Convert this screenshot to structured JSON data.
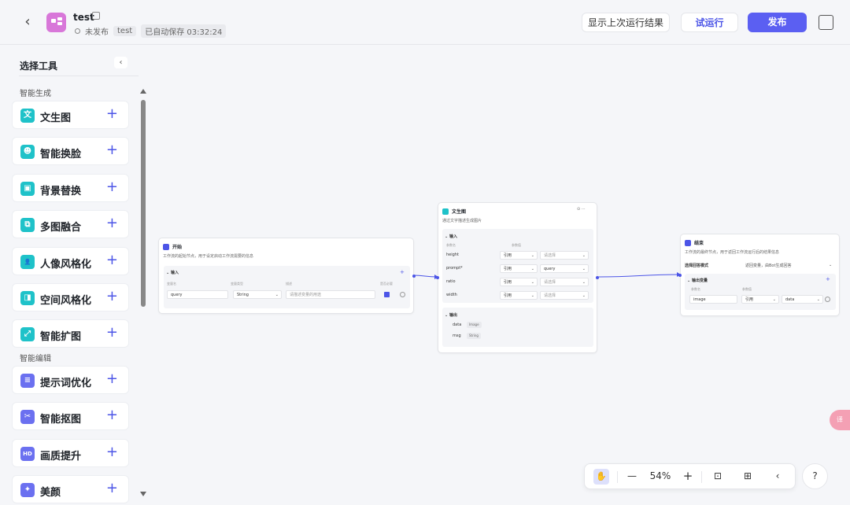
{
  "header": {
    "title": "test",
    "status": "未发布",
    "tag": "test",
    "autosave": "已自动保存 03:32:24",
    "buttons": {
      "last_result": "显示上次运行结果",
      "try_run": "试运行",
      "publish": "发布"
    }
  },
  "sidebar": {
    "title": "选择工具",
    "sections": [
      {
        "label": "智能生成",
        "items": [
          {
            "label": "文生图",
            "icon": "text-to-image-icon",
            "color": "#1fc2c9",
            "glyph": "文"
          },
          {
            "label": "智能换脸",
            "icon": "face-swap-icon",
            "color": "#1fc2c9",
            "glyph": "☻"
          },
          {
            "label": "背景替换",
            "icon": "background-replace-icon",
            "color": "#1fc2c9",
            "glyph": "▣"
          },
          {
            "label": "多图融合",
            "icon": "multi-image-fusion-icon",
            "color": "#1fc2c9",
            "glyph": "⧉"
          },
          {
            "label": "人像风格化",
            "icon": "portrait-stylize-icon",
            "color": "#1fc2c9",
            "glyph": "👤"
          },
          {
            "label": "空间风格化",
            "icon": "space-stylize-icon",
            "color": "#1fc2c9",
            "glyph": "◨"
          },
          {
            "label": "智能扩图",
            "icon": "image-expand-icon",
            "color": "#1fc2c9",
            "glyph": "⤢"
          }
        ]
      },
      {
        "label": "智能编辑",
        "items": [
          {
            "label": "提示词优化",
            "icon": "prompt-optimize-icon",
            "color": "#6b70f0",
            "glyph": "≡"
          },
          {
            "label": "智能抠图",
            "icon": "smart-cutout-icon",
            "color": "#6b70f0",
            "glyph": "✂"
          },
          {
            "label": "画质提升",
            "icon": "quality-enhance-icon",
            "color": "#6b70f0",
            "glyph": "HD"
          },
          {
            "label": "美颜",
            "icon": "beauty-icon",
            "color": "#6b70f0",
            "glyph": "✦"
          }
        ]
      }
    ]
  },
  "nodes": {
    "start": {
      "title": "开始",
      "desc": "工作流的起始节点，用于设定启动工作流需要的信息",
      "input_label": "输入",
      "cols": [
        "变量名",
        "变量类型",
        "描述",
        "是否必要"
      ],
      "row": {
        "name": "query",
        "type": "String",
        "desc_placeholder": "请描述变量的用途"
      }
    },
    "t2i": {
      "title": "文生图",
      "desc": "通过文字描述生成图片",
      "input_label": "输入",
      "cols": [
        "参数名",
        "参数值"
      ],
      "params": [
        {
          "name": "height",
          "mode": "引用",
          "value": "请选择",
          "placeholder": true
        },
        {
          "name": "prompt*",
          "mode": "引用",
          "value": "query",
          "placeholder": false
        },
        {
          "name": "ratio",
          "mode": "引用",
          "value": "请选择",
          "placeholder": true
        },
        {
          "name": "width",
          "mode": "引用",
          "value": "请选择",
          "placeholder": true
        }
      ],
      "output_label": "输出",
      "outputs": [
        {
          "name": "data",
          "type": "Image"
        },
        {
          "name": "msg",
          "type": "String"
        }
      ]
    },
    "end": {
      "title": "结束",
      "desc": "工作流的最终节点，用于返回工作流运行后的结果信息",
      "mode_label": "选择回答模式",
      "mode_value": "返回变量，由Bot生成回答",
      "output_label": "输出变量",
      "cols": [
        "参数名",
        "参数值"
      ],
      "row": {
        "name": "image",
        "mode": "引用",
        "value": "data"
      }
    }
  },
  "zoom": {
    "level": "54%"
  },
  "help": "?"
}
